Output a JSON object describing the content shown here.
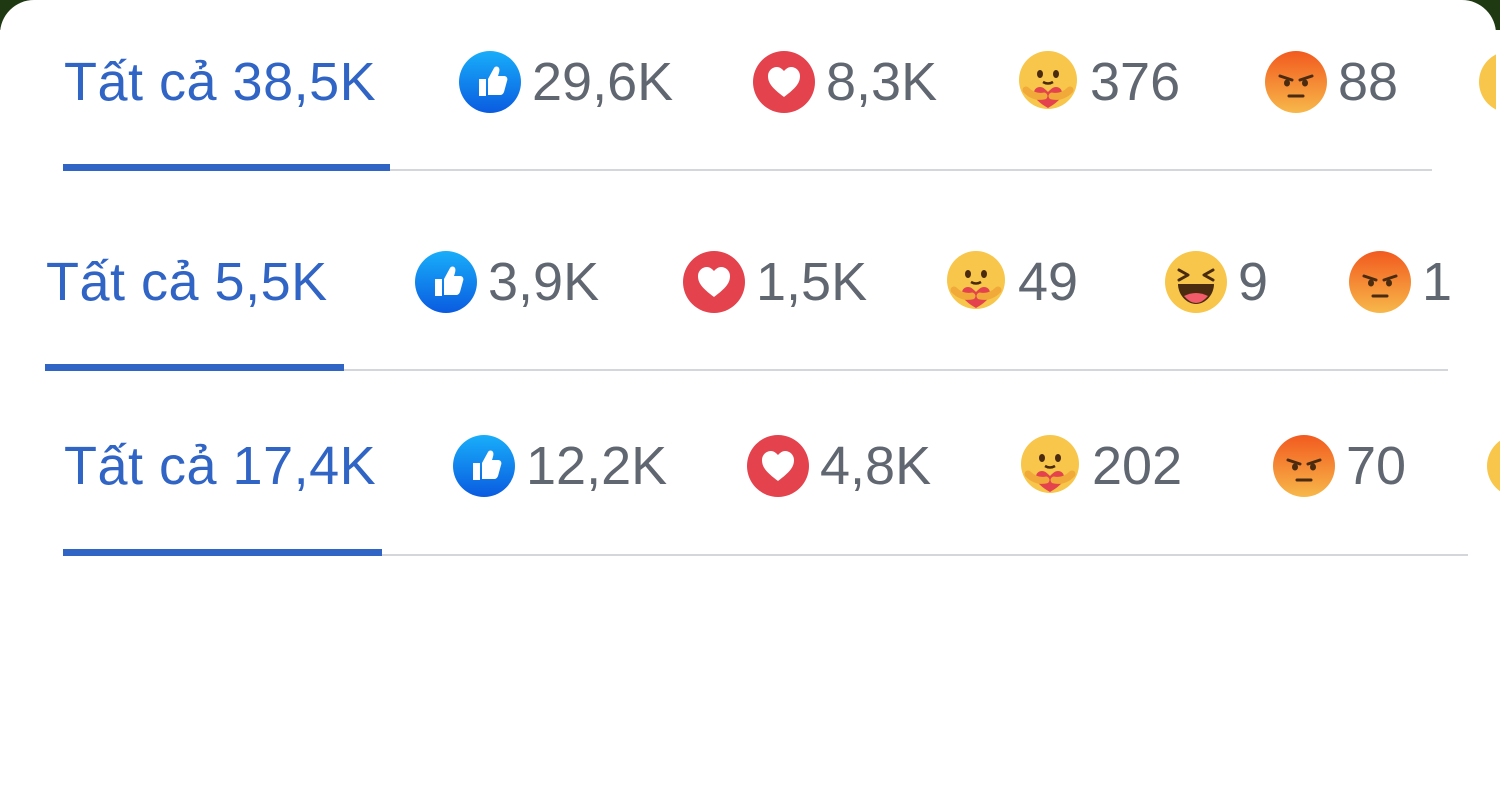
{
  "panels": [
    {
      "all_label": "Tất cả 38,5K",
      "reactions": [
        {
          "icon": "like-icon",
          "count": "29,6K"
        },
        {
          "icon": "love-icon",
          "count": "8,3K"
        },
        {
          "icon": "care-icon",
          "count": "376"
        },
        {
          "icon": "angry-icon",
          "count": "88"
        }
      ]
    },
    {
      "all_label": "Tất cả 5,5K",
      "reactions": [
        {
          "icon": "like-icon",
          "count": "3,9K"
        },
        {
          "icon": "love-icon",
          "count": "1,5K"
        },
        {
          "icon": "care-icon",
          "count": "49"
        },
        {
          "icon": "haha-icon",
          "count": "9"
        },
        {
          "icon": "angry-icon",
          "count": "1"
        }
      ]
    },
    {
      "all_label": "Tất cả 17,4K",
      "reactions": [
        {
          "icon": "like-icon",
          "count": "12,2K"
        },
        {
          "icon": "love-icon",
          "count": "4,8K"
        },
        {
          "icon": "care-icon",
          "count": "202"
        },
        {
          "icon": "angry-icon",
          "count": "70"
        }
      ]
    }
  ],
  "colors": {
    "accent": "#3064c5",
    "count_text": "#606770",
    "divider": "#d3d6db",
    "like": "#1877f2",
    "love": "#e4424d",
    "emoji_yellow": "#f7c64a",
    "angry_orange": "#e9711c"
  }
}
